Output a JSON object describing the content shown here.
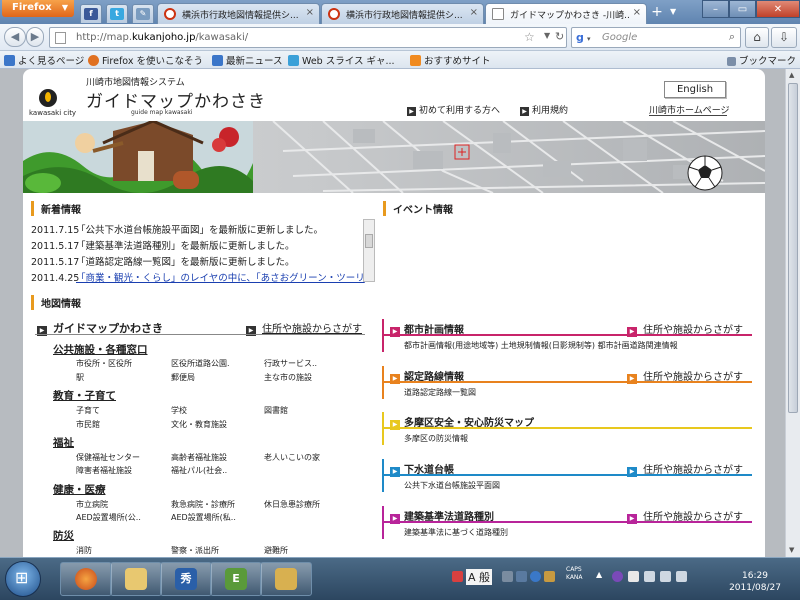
{
  "browser": {
    "menu_button": "Firefox",
    "tabs": [
      {
        "title": "横浜市行政地図情報提供シ..."
      },
      {
        "title": "横浜市行政地図情報提供シ..."
      },
      {
        "title": "ガイドマップかわさき -川崎..."
      }
    ],
    "address_prefix": "http://map.",
    "address_domain": "kukanjoho.jp",
    "address_suffix": "/kawasaki/",
    "search_engine": "Google",
    "search_placeholder": "Google",
    "bookmarks": [
      {
        "label": "よく見るページ",
        "color": "#3b76c9"
      },
      {
        "label": "Firefox を使いこなそう",
        "color": "#e07020"
      },
      {
        "label": "最新ニュース",
        "color": "#3b76c9"
      },
      {
        "label": "Web スライス ギャ...",
        "color": "#3aa0d8"
      },
      {
        "label": "おすすめサイト",
        "color": "#f08a20"
      }
    ],
    "bookmarks_menu": "ブックマーク"
  },
  "site": {
    "logo_caption": "kawasaki city",
    "system_name": "川崎市地図情報システム",
    "site_name": "ガイドマップかわさき",
    "site_subtitle": "guide map kawasaki",
    "lang_button": "English",
    "header_links": [
      "初めて利用する方へ",
      "利用規約",
      "川崎市ホームページ"
    ]
  },
  "news": {
    "title": "新着情報",
    "items": [
      {
        "date": "2011.7.15",
        "text": "「公共下水道台帳施設平面図」を最新版に更新しました。",
        "link": false
      },
      {
        "date": "2011.5.17",
        "text": "「建築基準法道路種別」を最新版に更新しました。",
        "link": false
      },
      {
        "date": "2011.5.17",
        "text": "「道路認定路線一覧図」を最新版に更新しました。",
        "link": false
      },
      {
        "date": "2011.4.25",
        "text": "「商業・観光・くらし」のレイヤの中に、「あさおグリーン・ツーリ",
        "link": true
      }
    ]
  },
  "event": {
    "title": "イベント情報"
  },
  "mapinfo": {
    "title": "地図情報",
    "guide_header": "ガイドマップかわさき",
    "search_link": "住所や施設からさがす",
    "categories": [
      {
        "title": "公共施設・各種窓口",
        "items": [
          "市役所・区役所",
          "区役所道路公園.",
          "行政サービス..",
          "駅",
          "郵便局",
          "主な市の施設"
        ]
      },
      {
        "title": "教育・子育て",
        "items": [
          "子育て",
          "学校",
          "図書館",
          "市民館",
          "文化・教育施設"
        ]
      },
      {
        "title": "福祉",
        "items": [
          "保健福祉センター",
          "高齢者福祉施設",
          "老人いこいの家",
          "障害者福祉施設",
          "福祉パル(社会.."
        ]
      },
      {
        "title": "健康・医療",
        "items": [
          "市立病院",
          "救急病院・診療所",
          "休日急患診療所",
          "AED設置場所(公..",
          "AED設置場所(私.."
        ]
      },
      {
        "title": "防災",
        "items": [
          "消防",
          "警察・派出所",
          "避難所"
        ]
      }
    ],
    "sections": [
      {
        "title": "都市計画情報",
        "color": "#c8246a",
        "search": "住所や施設からさがす",
        "desc": "都市計画情報(用途地域等)  土地規制情報(日影規制等)  都市計画道路関連情報"
      },
      {
        "title": "認定路線情報",
        "color": "#e8821e",
        "search": "住所や施設からさがす",
        "desc": "道路認定路線一覧図"
      },
      {
        "title": "多摩区安全・安心防災マップ",
        "color": "#e8c81e",
        "search": "",
        "desc": "多摩区の防災情報"
      },
      {
        "title": "下水道台帳",
        "color": "#1e8ac8",
        "search": "住所や施設からさがす",
        "desc": "公共下水道台帳施設平面図"
      },
      {
        "title": "建築基準法道路種別",
        "color": "#b8249a",
        "search": "住所や施設からさがす",
        "desc": "建築基準法に基づく道路種別"
      }
    ]
  },
  "taskbar": {
    "tray_label_caps": "CAPS",
    "tray_label_kana": "KANA",
    "ime": "A 般",
    "time": "16:29",
    "date": "2011/08/27"
  }
}
